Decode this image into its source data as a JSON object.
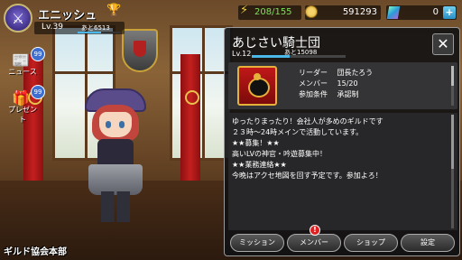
{
  "player": {
    "name": "エニッシュ",
    "level_label": "Lv.39",
    "exp_remaining": "あと6513",
    "exp_progress": 0.55
  },
  "side_menu": [
    {
      "label": "ニュース",
      "badge": "99"
    },
    {
      "label": "プレゼント",
      "badge": "99"
    }
  ],
  "location": "ギルド協会本部",
  "resources": {
    "stamina": "208/155",
    "coins": "591293",
    "gems": "0",
    "add_label": "+"
  },
  "guild": {
    "name": "あじさい騎士団",
    "level_label": "Lv.12",
    "exp_remaining": "あと15098",
    "exp_progress": 0.4,
    "close_label": "✕",
    "info": [
      {
        "key": "リーダー",
        "value": "団長たろう"
      },
      {
        "key": "メンバー",
        "value": "15/20"
      },
      {
        "key": "参加条件",
        "value": "承認制"
      }
    ],
    "description": [
      "ゆったりまったり！会社人が多めのギルドです",
      "２３時〜24時メインで活動しています。",
      "★★募集！★★",
      "高いLVの神官・吟遊募集中！",
      "★★業務連絡★★",
      "今晩はアクセ地図を回す予定です。参加よろ！"
    ]
  },
  "tabs": [
    {
      "label": "ミッション"
    },
    {
      "label": "メンバー",
      "alert": "!"
    },
    {
      "label": "ショップ"
    },
    {
      "label": "設定"
    }
  ],
  "colors": {
    "accent_blue": "#4ab8e8",
    "stamina_green": "#7fe05a",
    "alert_red": "#e02020",
    "emblem_red": "#c01818",
    "gold": "#e6b13a"
  },
  "icons": {
    "class": "crossed-swords-icon",
    "trophy": "trophy-icon",
    "news": "paper-icon",
    "present": "gift-icon",
    "stamina": "lightning-icon",
    "coin": "coin-icon",
    "gem": "crystal-icon",
    "close": "close-icon"
  }
}
